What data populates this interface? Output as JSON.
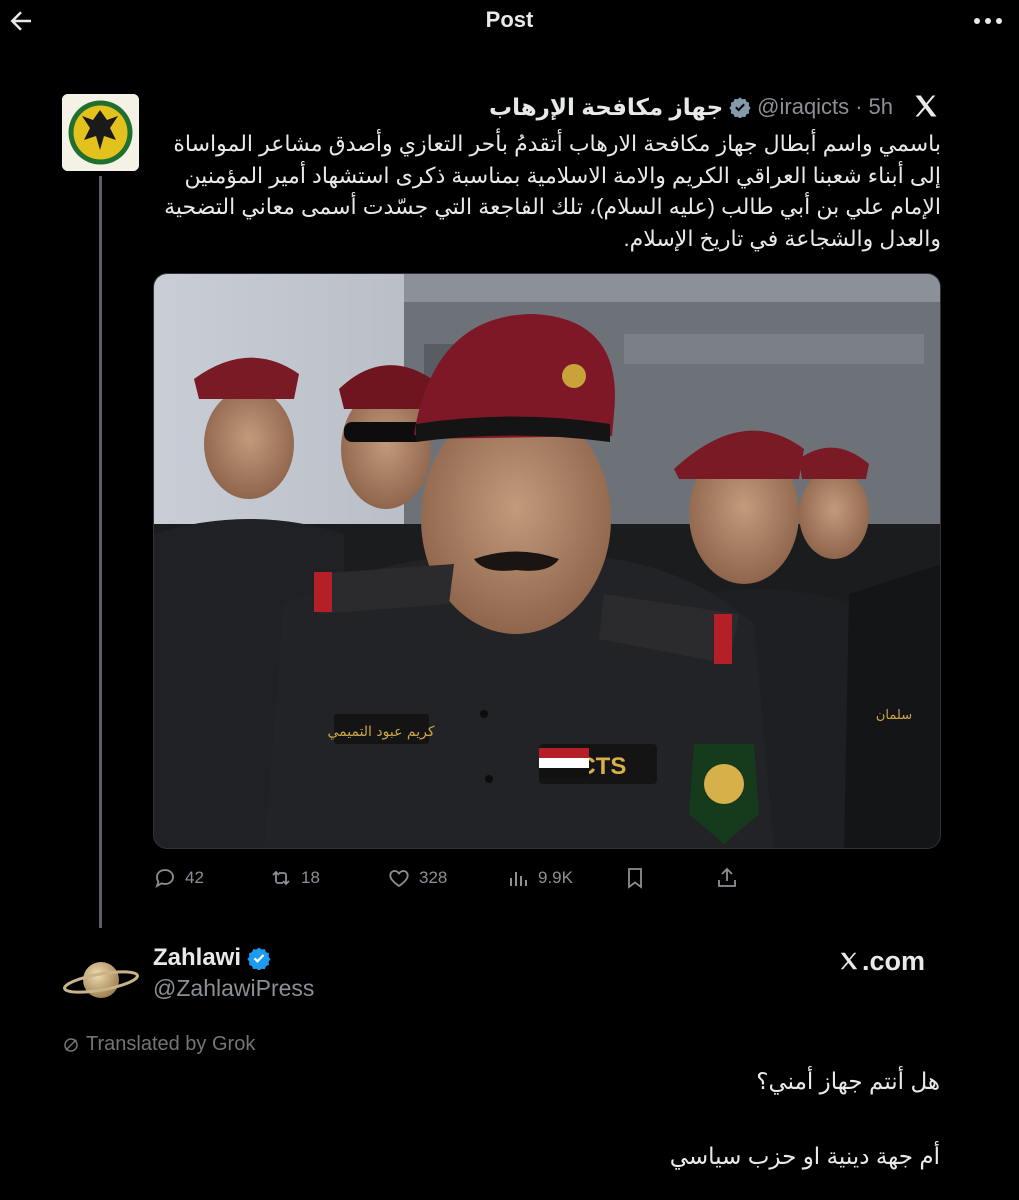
{
  "header": {
    "title": "Post",
    "back_icon": "arrow-left-icon",
    "more_icon": "more-horizontal-icon"
  },
  "quoted_post": {
    "author_name": "جهاز مكافحة الإرهاب",
    "verified": "gray-verified-badge",
    "handle": "@iraqicts",
    "separator": "·",
    "time": "5h",
    "platform_icon": "x-logo-icon",
    "text": "باسمي واسم أبطال جهاز مكافحة الارهاب أتقدمُ بأحر التعازي وأصدق مشاعر المواساة إلى أبناء شعبنا العراقي الكريم والامة الاسلامية بمناسبة ذكرى استشهاد أمير المؤمنين الإمام علي بن أبي طالب (عليه السلام)، تلك الفاجعة التي جسّدت أسمى معاني التضحية والعدل والشجاعة في تاريخ الإسلام.",
    "media": {
      "badge_text": "ICTS",
      "name_tape": "كريم عبود التميمي",
      "side_tape": "سلمان",
      "beret_color": "#7a1a24"
    },
    "actions": {
      "replies": "42",
      "reposts": "18",
      "likes": "328",
      "views": "9.9K"
    }
  },
  "reply": {
    "author_name": "Zahlawi",
    "verified": "blue-verified-badge",
    "handle": "@ZahlawiPress",
    "source": ".com",
    "translated_label": "Translated by Grok",
    "line1": "هل أنتم جهاز أمني؟",
    "line2": "أم جهة دينية او حزب سياسي"
  },
  "colors": {
    "background": "#000000",
    "text": "#e7e9ea",
    "muted": "#8b9096",
    "thread_line": "#5b6066",
    "verified_blue": "#1d9bf0",
    "verified_gray": "#829aab"
  }
}
